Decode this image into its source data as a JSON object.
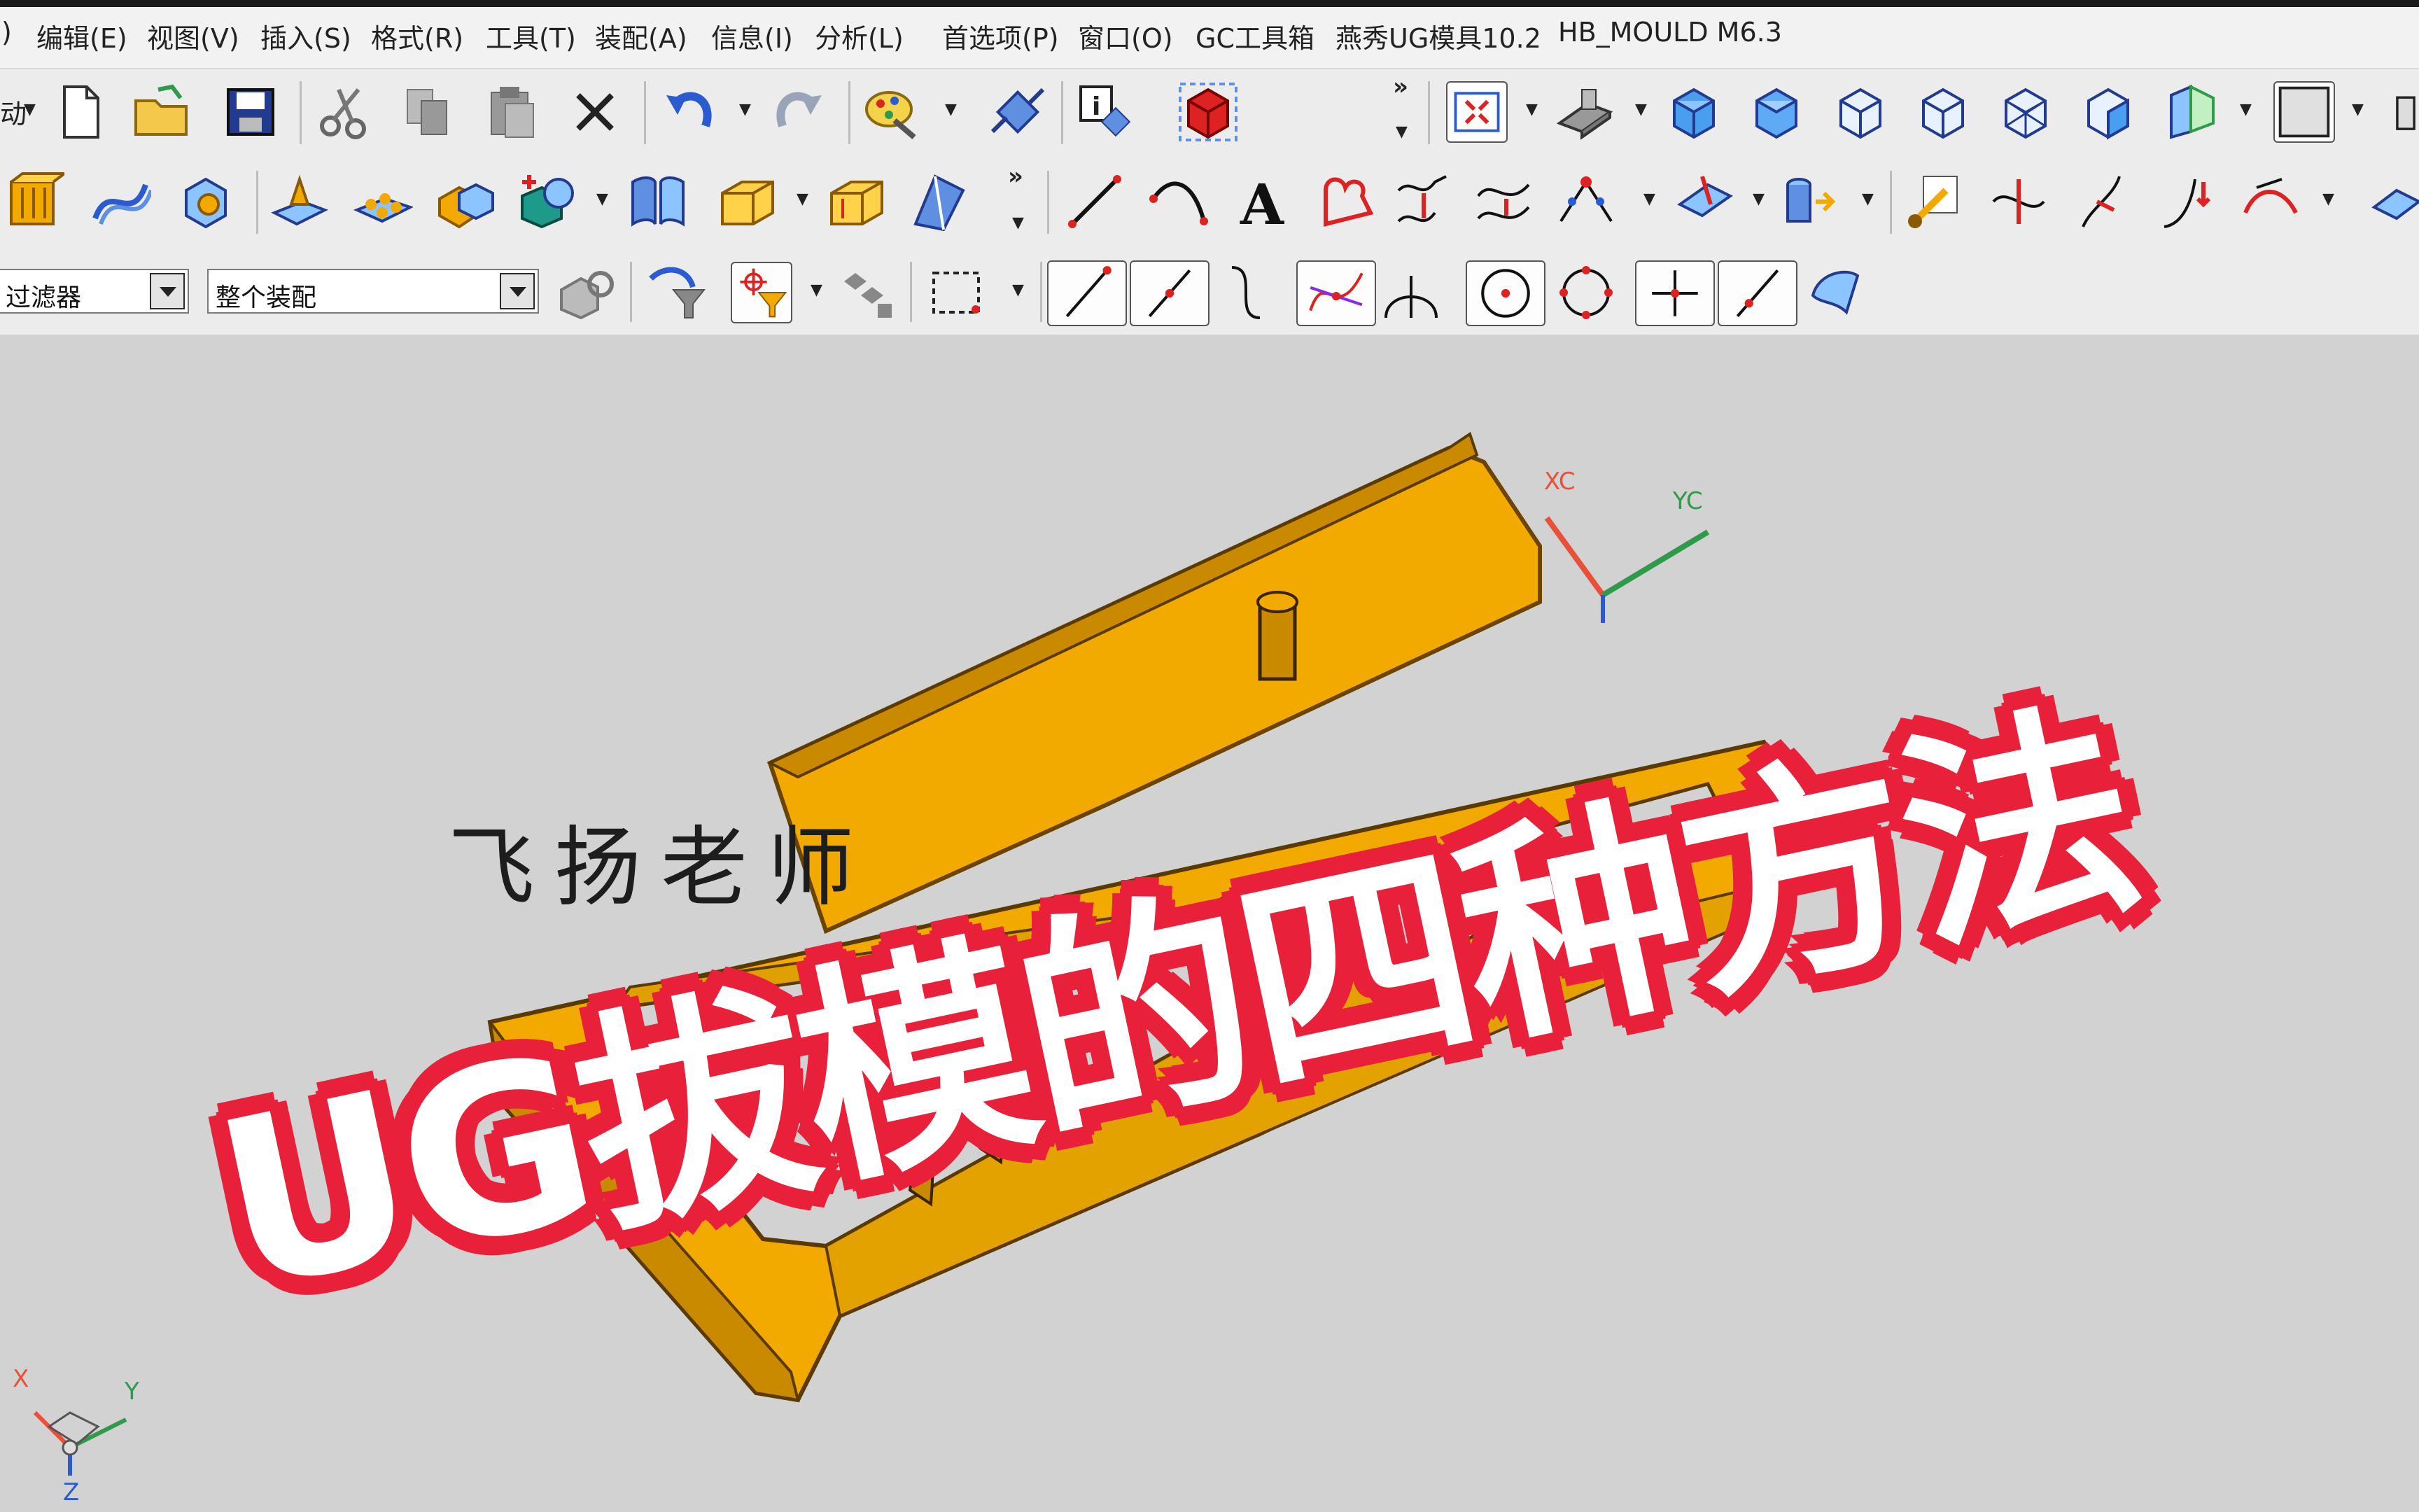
{
  "menubar": {
    "items": [
      "编辑(E)",
      "视图(V)",
      "插入(S)",
      "格式(R)",
      "工具(T)",
      "装配(A)",
      "信息(I)",
      "分析(L)",
      "首选项(P)",
      "窗口(O)",
      "GC工具箱",
      "燕秀UG模具10.2",
      "HB_MOULD M6.3"
    ],
    "left_fragment": ")"
  },
  "toolbar1": {
    "start_fragment": "动"
  },
  "selection_bar": {
    "type_filter": "过滤器",
    "scope_filter": "整个装配"
  },
  "viewport": {
    "watermark": "飞扬老师",
    "title_overlay": "UG拔模的四种方法",
    "wcs": {
      "xc_label": "XC",
      "yc_label": "YC",
      "xc_color": "#e8503a",
      "yc_color": "#2e9a4a"
    },
    "absolute_csys": {
      "x_label": "X",
      "y_label": "Y",
      "z_label": "Z"
    },
    "part_color": "#f2a900",
    "background": "#d2d2d2"
  },
  "colors": {
    "overlay_text": "#ffffff",
    "overlay_outline": "#e8203a"
  }
}
